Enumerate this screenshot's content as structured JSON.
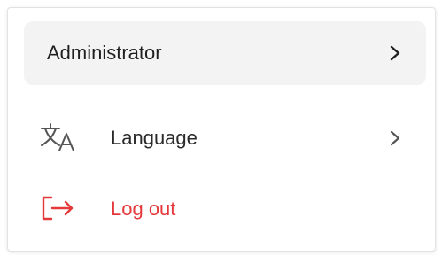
{
  "menu": {
    "user": {
      "name": "Administrator",
      "chevron_icon": "chevron-right-icon"
    },
    "items": [
      {
        "label": "Language",
        "icon": "translate-icon",
        "chevron_icon": "chevron-right-icon",
        "color": "#2a2a2a"
      },
      {
        "label": "Log out",
        "icon": "logout-icon",
        "color": "#e5383b"
      }
    ]
  },
  "colors": {
    "user_row_background": "#f3f3f3",
    "danger": "#e5383b",
    "text": "#1f1f1f",
    "icon_gray": "#555555"
  }
}
